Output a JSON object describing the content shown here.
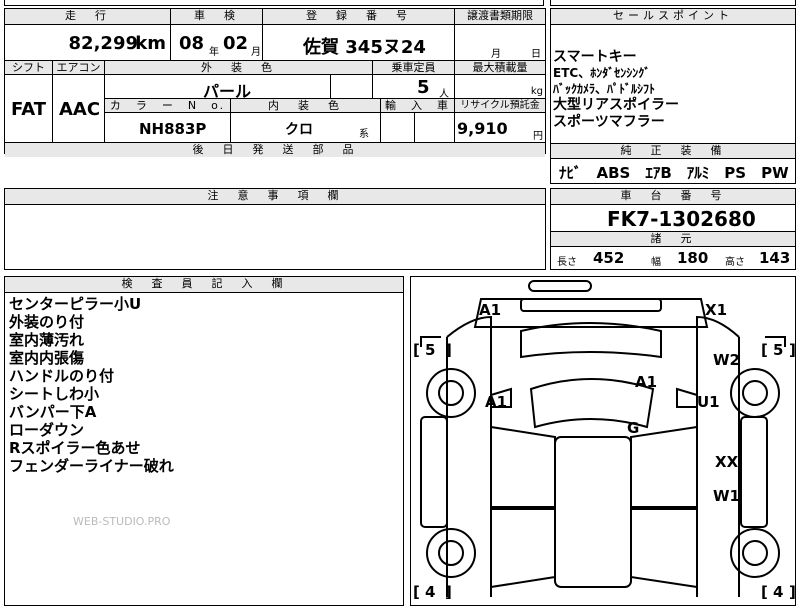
{
  "top_row": {
    "mileage_header": "走　行",
    "inspection_header": "車　検",
    "registration_header": "登　録　番　号",
    "transfer_header": "譲渡書類期限",
    "mileage_value": "82,299",
    "mileage_unit": "km",
    "inspection_year": "08",
    "inspection_year_unit": "年",
    "inspection_month": "02",
    "inspection_month_unit": "月",
    "registration_value": "佐賀 345ヌ24",
    "transfer_month_unit": "月",
    "transfer_day_unit": "日"
  },
  "spec_row": {
    "shift_header": "シフト",
    "ac_header": "エアコン",
    "exterior_color_header": "外　装　色",
    "capacity_header": "乗車定員",
    "max_load_header": "最大積載量",
    "shift_value": "FAT",
    "ac_value": "AAC",
    "exterior_color_value": "パール",
    "capacity_value": "5",
    "capacity_unit": "人",
    "max_load_unit": "kg",
    "color_no_header": "カ　ラ　ー　N　o.",
    "interior_color_header": "内　装　色",
    "import_header": "輸　入　車",
    "recycle_header": "リサイクル預託金",
    "color_no_value": "NH883P",
    "interior_color_value": "クロ",
    "interior_color_suffix": "系",
    "recycle_value": "9,910",
    "recycle_unit": "円",
    "later_parts_header": "後　日　発　送　部　品"
  },
  "sales_points": {
    "header": "セールスポイント",
    "items": [
      "スマートキー",
      "ETC、ﾎﾝﾀﾞｾﾝｼﾝｸﾞ",
      "ﾊﾞｯｸｶﾒﾗ、ﾊﾟﾄﾞﾙｼﾌﾄ",
      "大型リアスポイラー",
      "スポーツマフラー"
    ]
  },
  "genuine_equipment": {
    "header": "純　正　装　備",
    "value": "ﾅﾋﾞ　ABS　ｴｱB　ｱﾙﾐ　PS　PW"
  },
  "notes": {
    "header": "注　意　事　項　欄"
  },
  "chassis": {
    "header": "車　台　番　号",
    "value": "FK7-1302680",
    "dimensions_header": "諸　元",
    "length_label": "長さ",
    "length_value": "452",
    "width_label": "幅",
    "width_value": "180",
    "height_label": "高さ",
    "height_value": "143"
  },
  "inspector": {
    "header": "検　査　員　記　入　欄",
    "lines": [
      "センターピラー小U",
      "外装のり付",
      "室内薄汚れ",
      "室内内張傷",
      "ハンドルのり付",
      "シートしわ小",
      "バンパー下A",
      "ローダウン",
      "Rスポイラー色あせ",
      "フェンダーライナー破れ"
    ]
  },
  "watermark": "WEB-STUDIO.PRO",
  "diagram": {
    "marks": [
      {
        "id": "front-left",
        "text": "A1"
      },
      {
        "id": "front-right",
        "text": "X1"
      },
      {
        "id": "hood",
        "text": "A1"
      },
      {
        "id": "left-front-door",
        "text": "A1"
      },
      {
        "id": "right-fender",
        "text": "W2"
      },
      {
        "id": "right-front-door",
        "text": "U1"
      },
      {
        "id": "roof",
        "text": "G"
      },
      {
        "id": "right-rear-door",
        "text": "XX"
      },
      {
        "id": "right-rear-quarter",
        "text": "W1"
      }
    ],
    "tires": [
      {
        "id": "front-left",
        "text": "5"
      },
      {
        "id": "front-right",
        "text": "5"
      },
      {
        "id": "rear-left",
        "text": "4"
      },
      {
        "id": "rear-right",
        "text": "4"
      }
    ]
  }
}
